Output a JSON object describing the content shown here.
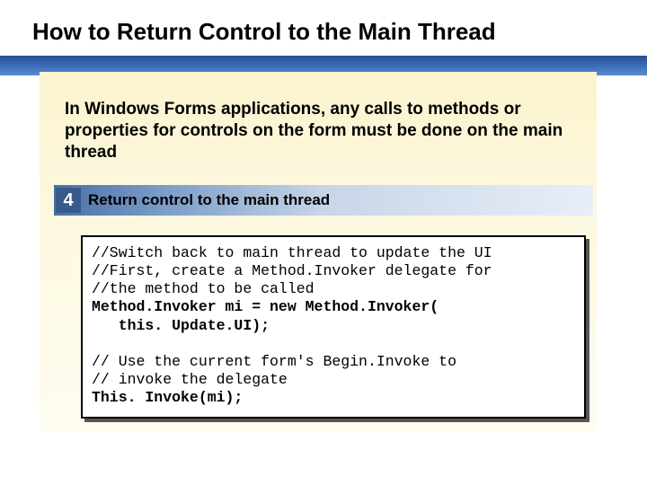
{
  "title": "How to Return Control to the Main Thread",
  "intro": "In Windows Forms applications, any calls to methods or properties for controls on the form  must be done on the main thread",
  "step": {
    "number": "4",
    "label": "Return control to the main thread"
  },
  "code": {
    "l1": "//Switch back to main thread to update the UI",
    "l2": "//First, create a Method.Invoker delegate for",
    "l3": "//the method to be called",
    "l4": "Method.Invoker mi = new Method.Invoker(",
    "l5": "   this. Update.UI);",
    "l6": "",
    "l7": "// Use the current form's Begin.Invoke to",
    "l8": "// invoke the delegate",
    "l9": "This. Invoke(mi);"
  }
}
